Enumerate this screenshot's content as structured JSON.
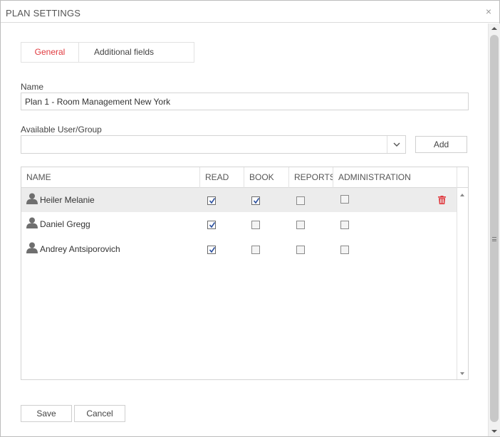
{
  "dialog": {
    "title": "PLAN SETTINGS",
    "close_symbol": "×"
  },
  "tabs": [
    {
      "label": "General",
      "active": true
    },
    {
      "label": "Additional fields",
      "active": false
    }
  ],
  "form": {
    "name_label": "Name",
    "name_value": "Plan 1 - Room Management New York",
    "user_group_label": "Available User/Group",
    "user_group_value": "",
    "add_label": "Add"
  },
  "grid": {
    "columns": [
      "NAME",
      "READ",
      "BOOK",
      "REPORTS",
      "ADMINISTRATION"
    ],
    "rows": [
      {
        "name": "Heiler Melanie",
        "read": true,
        "book": true,
        "reports": false,
        "administration": false,
        "selected": true
      },
      {
        "name": "Daniel Gregg",
        "read": true,
        "book": false,
        "reports": false,
        "administration": false,
        "selected": false
      },
      {
        "name": "Andrey Antsiporovich",
        "read": true,
        "book": false,
        "reports": false,
        "administration": false,
        "selected": false
      }
    ]
  },
  "footer": {
    "save_label": "Save",
    "cancel_label": "Cancel"
  },
  "colors": {
    "accent": "#e0393e",
    "checkmark": "#2b4f9e",
    "user_icon": "#6f6f6f"
  },
  "icons": {
    "close": "close-icon",
    "user": "user-icon",
    "delete": "trash-icon",
    "dropdown": "chevron-down-icon"
  }
}
